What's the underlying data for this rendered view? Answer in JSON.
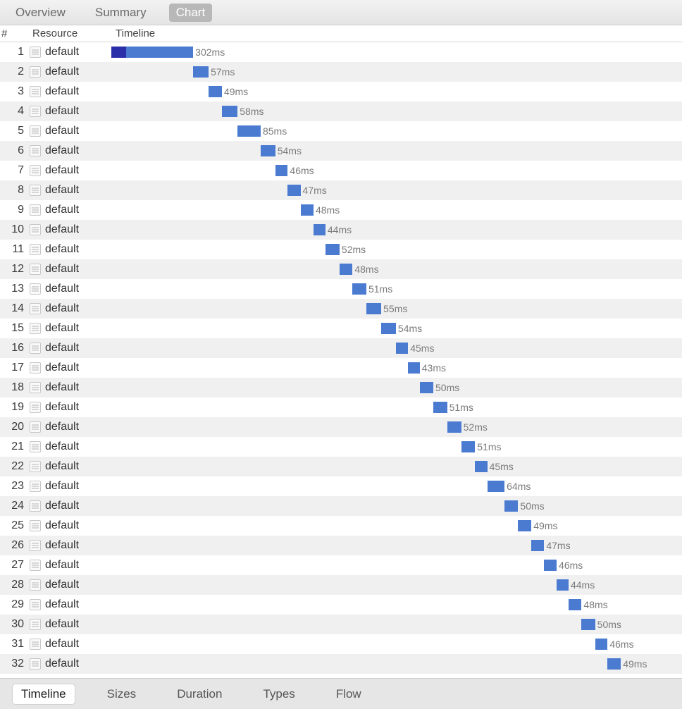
{
  "top_tabs": {
    "overview": "Overview",
    "summary": "Summary",
    "chart": "Chart",
    "active": "chart"
  },
  "columns": {
    "number": "#",
    "resource": "Resource",
    "timeline": "Timeline"
  },
  "bottom_tabs": {
    "timeline": "Timeline",
    "sizes": "Sizes",
    "duration": "Duration",
    "types": "Types",
    "flow": "Flow",
    "active": "timeline"
  },
  "chart_data": {
    "type": "bar",
    "title": "",
    "xlabel": "Timeline",
    "ylabel": "",
    "unit": "ms",
    "total_span_ms": 1800,
    "series": [
      {
        "name": "duration",
        "items": [
          {
            "n": 1,
            "resource": "default",
            "start": 0,
            "dur": 302,
            "highlight": true
          },
          {
            "n": 2,
            "resource": "default",
            "start": 302,
            "dur": 57
          },
          {
            "n": 3,
            "resource": "default",
            "start": 359,
            "dur": 49
          },
          {
            "n": 4,
            "resource": "default",
            "start": 408,
            "dur": 58
          },
          {
            "n": 5,
            "resource": "default",
            "start": 466,
            "dur": 85
          },
          {
            "n": 6,
            "resource": "default",
            "start": 551,
            "dur": 54
          },
          {
            "n": 7,
            "resource": "default",
            "start": 605,
            "dur": 46
          },
          {
            "n": 8,
            "resource": "default",
            "start": 651,
            "dur": 47
          },
          {
            "n": 9,
            "resource": "default",
            "start": 698,
            "dur": 48
          },
          {
            "n": 10,
            "resource": "default",
            "start": 746,
            "dur": 44
          },
          {
            "n": 11,
            "resource": "default",
            "start": 790,
            "dur": 52
          },
          {
            "n": 12,
            "resource": "default",
            "start": 842,
            "dur": 48
          },
          {
            "n": 13,
            "resource": "default",
            "start": 890,
            "dur": 51
          },
          {
            "n": 14,
            "resource": "default",
            "start": 941,
            "dur": 55
          },
          {
            "n": 15,
            "resource": "default",
            "start": 996,
            "dur": 54
          },
          {
            "n": 16,
            "resource": "default",
            "start": 1050,
            "dur": 45
          },
          {
            "n": 17,
            "resource": "default",
            "start": 1095,
            "dur": 43
          },
          {
            "n": 18,
            "resource": "default",
            "start": 1138,
            "dur": 50
          },
          {
            "n": 19,
            "resource": "default",
            "start": 1188,
            "dur": 51
          },
          {
            "n": 20,
            "resource": "default",
            "start": 1239,
            "dur": 52
          },
          {
            "n": 21,
            "resource": "default",
            "start": 1291,
            "dur": 51
          },
          {
            "n": 22,
            "resource": "default",
            "start": 1342,
            "dur": 45
          },
          {
            "n": 23,
            "resource": "default",
            "start": 1387,
            "dur": 64
          },
          {
            "n": 24,
            "resource": "default",
            "start": 1451,
            "dur": 50
          },
          {
            "n": 25,
            "resource": "default",
            "start": 1501,
            "dur": 49
          },
          {
            "n": 26,
            "resource": "default",
            "start": 1550,
            "dur": 47
          },
          {
            "n": 27,
            "resource": "default",
            "start": 1597,
            "dur": 46
          },
          {
            "n": 28,
            "resource": "default",
            "start": 1643,
            "dur": 44
          },
          {
            "n": 29,
            "resource": "default",
            "start": 1687,
            "dur": 48
          },
          {
            "n": 30,
            "resource": "default",
            "start": 1735,
            "dur": 50
          },
          {
            "n": 31,
            "resource": "default",
            "start": 1785,
            "dur": 46
          },
          {
            "n": 32,
            "resource": "default",
            "start": 1831,
            "dur": 49
          }
        ]
      }
    ]
  }
}
